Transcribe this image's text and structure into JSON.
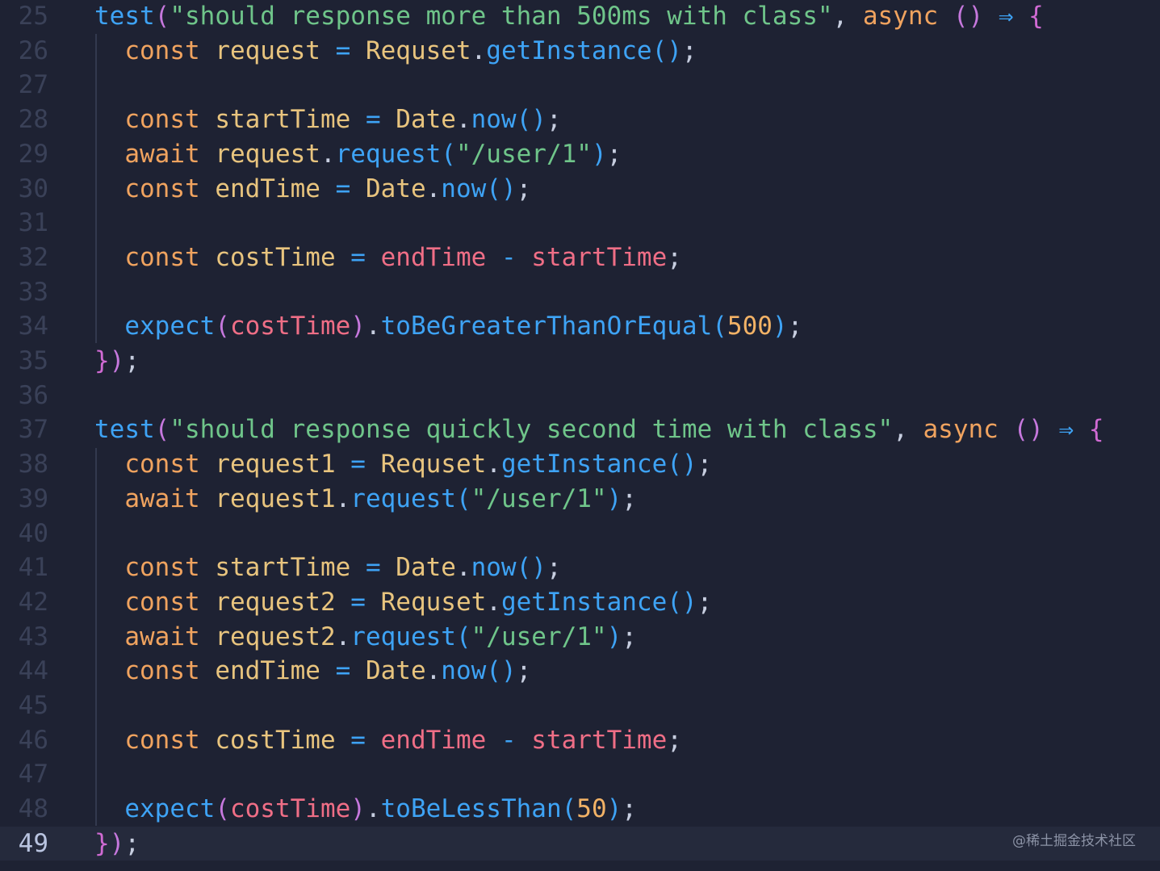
{
  "editor": {
    "colors": {
      "background": "#1e2233",
      "current_line": "#252a3c",
      "gutter": "#3a4158",
      "function": "#3ea3f5",
      "string": "#6fc58a",
      "keyword": "#f0a35f",
      "variable": "#ef6e86",
      "number": "#f2b266"
    },
    "current_line": "49",
    "lines": [
      {
        "num": "25",
        "tokens": [
          {
            "t": "test",
            "c": "fn"
          },
          {
            "t": "(",
            "c": "paren2"
          },
          {
            "t": "\"should response more than 500ms with class\"",
            "c": "str"
          },
          {
            "t": ", ",
            "c": "punc"
          },
          {
            "t": "async ",
            "c": "kw"
          },
          {
            "t": "() ",
            "c": "paren2"
          },
          {
            "t": "⇒ ",
            "c": "op"
          },
          {
            "t": "{",
            "c": "brace"
          }
        ]
      },
      {
        "num": "26",
        "tokens": [
          {
            "t": "  const ",
            "c": "kw"
          },
          {
            "t": "request ",
            "c": "id"
          },
          {
            "t": "= ",
            "c": "op"
          },
          {
            "t": "Requset",
            "c": "class"
          },
          {
            "t": ".",
            "c": "punc"
          },
          {
            "t": "getInstance",
            "c": "fn"
          },
          {
            "t": "()",
            "c": "paren"
          },
          {
            "t": ";",
            "c": "punc"
          }
        ]
      },
      {
        "num": "27",
        "tokens": []
      },
      {
        "num": "28",
        "tokens": [
          {
            "t": "  const ",
            "c": "kw"
          },
          {
            "t": "startTime ",
            "c": "id"
          },
          {
            "t": "= ",
            "c": "op"
          },
          {
            "t": "Date",
            "c": "class"
          },
          {
            "t": ".",
            "c": "punc"
          },
          {
            "t": "now",
            "c": "fn"
          },
          {
            "t": "()",
            "c": "paren"
          },
          {
            "t": ";",
            "c": "punc"
          }
        ]
      },
      {
        "num": "29",
        "tokens": [
          {
            "t": "  await ",
            "c": "kw"
          },
          {
            "t": "request",
            "c": "id"
          },
          {
            "t": ".",
            "c": "punc"
          },
          {
            "t": "request",
            "c": "fn"
          },
          {
            "t": "(",
            "c": "paren"
          },
          {
            "t": "\"/user/1\"",
            "c": "str"
          },
          {
            "t": ")",
            "c": "paren"
          },
          {
            "t": ";",
            "c": "punc"
          }
        ]
      },
      {
        "num": "30",
        "tokens": [
          {
            "t": "  const ",
            "c": "kw"
          },
          {
            "t": "endTime ",
            "c": "id"
          },
          {
            "t": "= ",
            "c": "op"
          },
          {
            "t": "Date",
            "c": "class"
          },
          {
            "t": ".",
            "c": "punc"
          },
          {
            "t": "now",
            "c": "fn"
          },
          {
            "t": "()",
            "c": "paren"
          },
          {
            "t": ";",
            "c": "punc"
          }
        ]
      },
      {
        "num": "31",
        "tokens": []
      },
      {
        "num": "32",
        "tokens": [
          {
            "t": "  const ",
            "c": "kw"
          },
          {
            "t": "costTime ",
            "c": "id"
          },
          {
            "t": "= ",
            "c": "op"
          },
          {
            "t": "endTime ",
            "c": "var"
          },
          {
            "t": "- ",
            "c": "op"
          },
          {
            "t": "startTime",
            "c": "var"
          },
          {
            "t": ";",
            "c": "punc"
          }
        ]
      },
      {
        "num": "33",
        "tokens": []
      },
      {
        "num": "34",
        "tokens": [
          {
            "t": "  expect",
            "c": "fn"
          },
          {
            "t": "(",
            "c": "paren2"
          },
          {
            "t": "costTime",
            "c": "var"
          },
          {
            "t": ")",
            "c": "paren2"
          },
          {
            "t": ".",
            "c": "punc"
          },
          {
            "t": "toBeGreaterThanOrEqual",
            "c": "fn"
          },
          {
            "t": "(",
            "c": "paren"
          },
          {
            "t": "500",
            "c": "num"
          },
          {
            "t": ")",
            "c": "paren"
          },
          {
            "t": ";",
            "c": "punc"
          }
        ]
      },
      {
        "num": "35",
        "tokens": [
          {
            "t": "}",
            "c": "brace"
          },
          {
            "t": ")",
            "c": "paren2"
          },
          {
            "t": ";",
            "c": "punc"
          }
        ]
      },
      {
        "num": "36",
        "tokens": []
      },
      {
        "num": "37",
        "tokens": [
          {
            "t": "test",
            "c": "fn"
          },
          {
            "t": "(",
            "c": "paren2"
          },
          {
            "t": "\"should response quickly second time with class\"",
            "c": "str"
          },
          {
            "t": ", ",
            "c": "punc"
          },
          {
            "t": "async ",
            "c": "kw"
          },
          {
            "t": "() ",
            "c": "paren2"
          },
          {
            "t": "⇒ ",
            "c": "op"
          },
          {
            "t": "{",
            "c": "brace"
          }
        ]
      },
      {
        "num": "38",
        "tokens": [
          {
            "t": "  const ",
            "c": "kw"
          },
          {
            "t": "request1 ",
            "c": "id"
          },
          {
            "t": "= ",
            "c": "op"
          },
          {
            "t": "Requset",
            "c": "class"
          },
          {
            "t": ".",
            "c": "punc"
          },
          {
            "t": "getInstance",
            "c": "fn"
          },
          {
            "t": "()",
            "c": "paren"
          },
          {
            "t": ";",
            "c": "punc"
          }
        ]
      },
      {
        "num": "39",
        "tokens": [
          {
            "t": "  await ",
            "c": "kw"
          },
          {
            "t": "request1",
            "c": "id"
          },
          {
            "t": ".",
            "c": "punc"
          },
          {
            "t": "request",
            "c": "fn"
          },
          {
            "t": "(",
            "c": "paren"
          },
          {
            "t": "\"/user/1\"",
            "c": "str"
          },
          {
            "t": ")",
            "c": "paren"
          },
          {
            "t": ";",
            "c": "punc"
          }
        ]
      },
      {
        "num": "40",
        "tokens": []
      },
      {
        "num": "41",
        "tokens": [
          {
            "t": "  const ",
            "c": "kw"
          },
          {
            "t": "startTime ",
            "c": "id"
          },
          {
            "t": "= ",
            "c": "op"
          },
          {
            "t": "Date",
            "c": "class"
          },
          {
            "t": ".",
            "c": "punc"
          },
          {
            "t": "now",
            "c": "fn"
          },
          {
            "t": "()",
            "c": "paren"
          },
          {
            "t": ";",
            "c": "punc"
          }
        ]
      },
      {
        "num": "42",
        "tokens": [
          {
            "t": "  const ",
            "c": "kw"
          },
          {
            "t": "request2 ",
            "c": "id"
          },
          {
            "t": "= ",
            "c": "op"
          },
          {
            "t": "Requset",
            "c": "class"
          },
          {
            "t": ".",
            "c": "punc"
          },
          {
            "t": "getInstance",
            "c": "fn"
          },
          {
            "t": "()",
            "c": "paren"
          },
          {
            "t": ";",
            "c": "punc"
          }
        ]
      },
      {
        "num": "43",
        "tokens": [
          {
            "t": "  await ",
            "c": "kw"
          },
          {
            "t": "request2",
            "c": "id"
          },
          {
            "t": ".",
            "c": "punc"
          },
          {
            "t": "request",
            "c": "fn"
          },
          {
            "t": "(",
            "c": "paren"
          },
          {
            "t": "\"/user/1\"",
            "c": "str"
          },
          {
            "t": ")",
            "c": "paren"
          },
          {
            "t": ";",
            "c": "punc"
          }
        ]
      },
      {
        "num": "44",
        "tokens": [
          {
            "t": "  const ",
            "c": "kw"
          },
          {
            "t": "endTime ",
            "c": "id"
          },
          {
            "t": "= ",
            "c": "op"
          },
          {
            "t": "Date",
            "c": "class"
          },
          {
            "t": ".",
            "c": "punc"
          },
          {
            "t": "now",
            "c": "fn"
          },
          {
            "t": "()",
            "c": "paren"
          },
          {
            "t": ";",
            "c": "punc"
          }
        ]
      },
      {
        "num": "45",
        "tokens": []
      },
      {
        "num": "46",
        "tokens": [
          {
            "t": "  const ",
            "c": "kw"
          },
          {
            "t": "costTime ",
            "c": "id"
          },
          {
            "t": "= ",
            "c": "op"
          },
          {
            "t": "endTime ",
            "c": "var"
          },
          {
            "t": "- ",
            "c": "op"
          },
          {
            "t": "startTime",
            "c": "var"
          },
          {
            "t": ";",
            "c": "punc"
          }
        ]
      },
      {
        "num": "47",
        "tokens": []
      },
      {
        "num": "48",
        "tokens": [
          {
            "t": "  expect",
            "c": "fn"
          },
          {
            "t": "(",
            "c": "paren2"
          },
          {
            "t": "costTime",
            "c": "var"
          },
          {
            "t": ")",
            "c": "paren2"
          },
          {
            "t": ".",
            "c": "punc"
          },
          {
            "t": "toBeLessThan",
            "c": "fn"
          },
          {
            "t": "(",
            "c": "paren"
          },
          {
            "t": "50",
            "c": "num"
          },
          {
            "t": ")",
            "c": "paren"
          },
          {
            "t": ";",
            "c": "punc"
          }
        ]
      },
      {
        "num": "49",
        "tokens": [
          {
            "t": "}",
            "c": "brace"
          },
          {
            "t": ")",
            "c": "paren2"
          },
          {
            "t": ";",
            "c": "punc"
          }
        ]
      }
    ]
  },
  "watermark": "@稀土掘金技术社区"
}
